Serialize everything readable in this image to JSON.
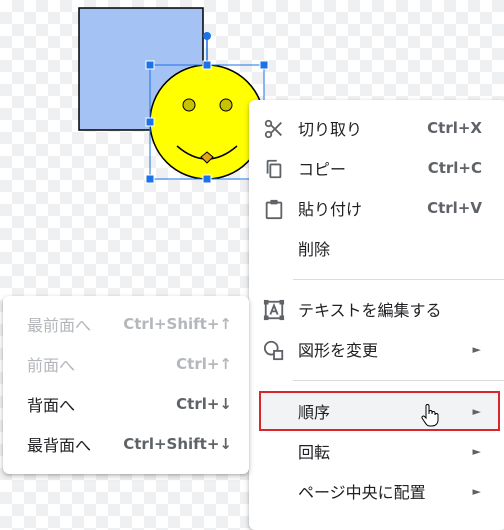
{
  "context_menu": {
    "items": [
      {
        "label": "切り取り",
        "shortcut": "Ctrl+X",
        "icon": "scissors-icon"
      },
      {
        "label": "コピー",
        "shortcut": "Ctrl+C",
        "icon": "copy-icon"
      },
      {
        "label": "貼り付け",
        "shortcut": "Ctrl+V",
        "icon": "clipboard-icon"
      },
      {
        "label": "削除"
      },
      {
        "label": "テキストを編集する",
        "icon": "text-box-icon"
      },
      {
        "label": "図形を変更",
        "icon": "shapes-icon"
      },
      {
        "label": "順序",
        "arrow": "►"
      },
      {
        "label": "回転",
        "arrow": "►"
      },
      {
        "label": "ページ中央に配置",
        "arrow": "►"
      }
    ]
  },
  "submenu": {
    "items": [
      {
        "label": "最前面へ",
        "shortcut": "Ctrl+Shift+↑",
        "enabled": false
      },
      {
        "label": "前面へ",
        "shortcut": "Ctrl+↑",
        "enabled": false
      },
      {
        "label": "背面へ",
        "shortcut": "Ctrl+↓",
        "enabled": true
      },
      {
        "label": "最背面へ",
        "shortcut": "Ctrl+Shift+↓",
        "enabled": true
      }
    ]
  },
  "canvas": {
    "shapes": [
      "blue-rectangle",
      "smiley-face"
    ],
    "colors": {
      "rect_fill": "#a4c2f4",
      "smiley_fill": "#ffff00",
      "smiley_eyes": "#c9c200",
      "nose_fill": "#e4a319",
      "selection": "#1a73e8",
      "highlight": "#d9252c"
    }
  }
}
